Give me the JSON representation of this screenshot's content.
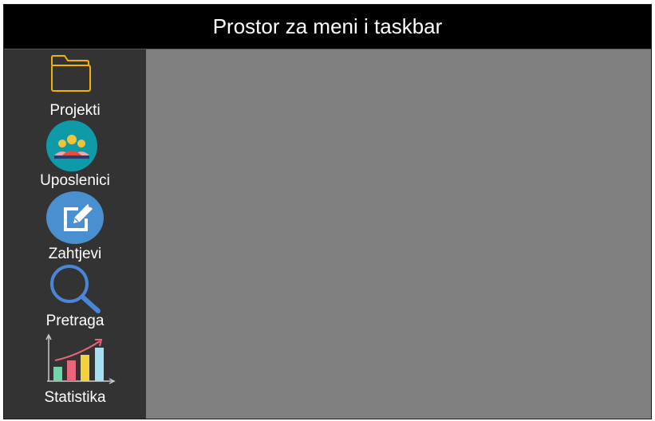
{
  "header": {
    "title": "Prostor za meni i taskbar"
  },
  "sidebar": {
    "items": [
      {
        "label": "Projekti",
        "icon": "folder-icon"
      },
      {
        "label": "Uposlenici",
        "icon": "team-icon"
      },
      {
        "label": "Zahtjevi",
        "icon": "edit-request-icon"
      },
      {
        "label": "Pretraga",
        "icon": "magnifier-icon"
      },
      {
        "label": "Statistika",
        "icon": "bar-chart-icon"
      }
    ]
  },
  "colors": {
    "header_bg": "#000000",
    "sidebar_bg": "#333333",
    "main_bg": "#808080",
    "folder_stroke": "#f0b400",
    "team_circle": "#0f9aa8",
    "edit_circle": "#4a90d0",
    "search_stroke": "#4a86d8"
  }
}
